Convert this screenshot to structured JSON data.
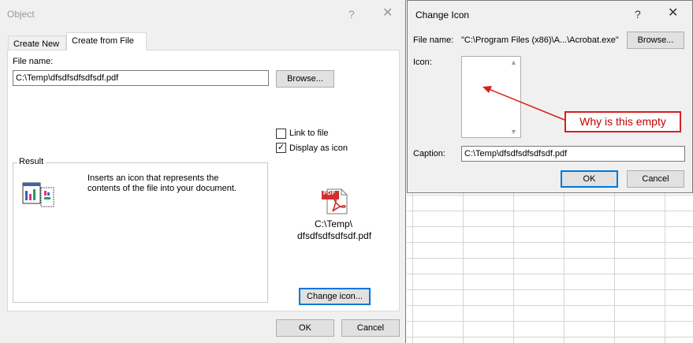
{
  "object_dialog": {
    "title": "Object",
    "help_glyph": "?",
    "close_glyph": "✕",
    "tabs": [
      {
        "label": "Create New"
      },
      {
        "label": "Create from File"
      }
    ],
    "file_name_label": "File name:",
    "file_name_value": "C:\\Temp\\dfsdfsdfsdfsdf.pdf",
    "browse_label": "Browse...",
    "link_to_file_label": "Link to file",
    "link_to_file_checked": false,
    "display_as_icon_label": "Display as icon",
    "display_as_icon_checked": true,
    "check_glyph": "✓",
    "result_label": "Result",
    "result_text_line1": "Inserts an icon that represents the",
    "result_text_line2": "contents of the file into your document.",
    "icon_caption_line1": "C:\\Temp\\",
    "icon_caption_line2": "dfsdfsdfsdfsdf.pdf",
    "pdf_badge": "PDF",
    "change_icon_label": "Change icon...",
    "ok_label": "OK",
    "cancel_label": "Cancel"
  },
  "change_icon_dialog": {
    "title": "Change Icon",
    "help_glyph": "?",
    "close_glyph": "✕",
    "file_name_label": "File name:",
    "file_name_value": "\"C:\\Program Files (x86)\\A...\\Acrobat.exe\"",
    "browse_label": "Browse...",
    "icon_label": "Icon:",
    "caption_label": "Caption:",
    "caption_value": "C:\\Temp\\dfsdfsdfsdfsdf.pdf",
    "ok_label": "OK",
    "cancel_label": "Cancel"
  },
  "annotation": {
    "callout_text": "Why is this empty",
    "color": "#d62020"
  }
}
